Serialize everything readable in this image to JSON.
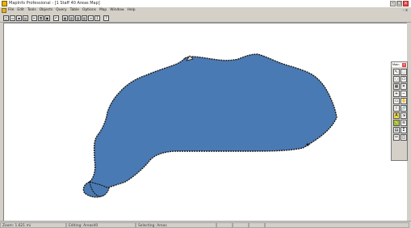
{
  "window": {
    "title": "MapInfo Professional - [1 Staff 40 Areas Map]",
    "controls": [
      "–",
      "□",
      "x"
    ]
  },
  "menubar": {
    "items": [
      "File",
      "Edit",
      "Tools",
      "Objects",
      "Query",
      "Table",
      "Options",
      "Map",
      "Window",
      "Help"
    ],
    "mdi_controls": [
      "–",
      "x"
    ]
  },
  "toolbar": {
    "icons": [
      "new-icon",
      "open-icon",
      "save-icon",
      "print-icon",
      "cut-icon",
      "copy-icon",
      "paste-icon",
      "undo-icon",
      "new-map-icon",
      "new-browser-icon",
      "new-graph-icon",
      "new-layout-icon",
      "legend-icon",
      "statistics-icon",
      "help-icon"
    ]
  },
  "map": {
    "region_fill": "#4a7ab3",
    "region_outline": "#1a1a1a",
    "background": "#ffffff"
  },
  "palette": {
    "title": "Main",
    "close": "x",
    "tools": [
      {
        "name": "select-arrow-icon",
        "glyph": "↖"
      },
      {
        "name": "marquee-select-icon",
        "glyph": "⬚"
      },
      {
        "name": "radius-select-icon",
        "glyph": "◌"
      },
      {
        "name": "polygon-select-icon",
        "glyph": "⬠"
      },
      {
        "name": "boundary-select-icon",
        "glyph": "▦"
      },
      {
        "name": "unselect-all-icon",
        "glyph": "✕"
      },
      {
        "name": "zoom-in-icon",
        "glyph": "+"
      },
      {
        "name": "zoom-out-icon",
        "glyph": "−"
      },
      {
        "name": "change-view-icon",
        "glyph": "▭"
      },
      {
        "name": "grabber-icon",
        "glyph": "✋"
      },
      {
        "name": "info-tool-icon",
        "glyph": "i"
      },
      {
        "name": "hotlink-icon",
        "glyph": "🔗"
      },
      {
        "name": "label-tool-icon",
        "glyph": "A"
      },
      {
        "name": "drag-map-window-icon",
        "glyph": "⇲"
      },
      {
        "name": "ruler-icon",
        "glyph": "📏"
      },
      {
        "name": "layer-control-icon",
        "glyph": "≡"
      },
      {
        "name": "show-legend-icon",
        "glyph": "▤"
      },
      {
        "name": "statistics-tool-icon",
        "glyph": "Σ"
      },
      {
        "name": "clip-region-icon",
        "glyph": "✂"
      },
      {
        "name": "set-clip-icon",
        "glyph": "◫"
      }
    ]
  },
  "statusbar": {
    "zoom": "Zoom: 1.621 mi",
    "editing": "Editing: Areas40",
    "selecting": "Selecting: Areas"
  }
}
